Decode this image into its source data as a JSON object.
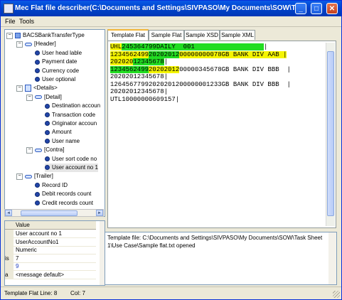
{
  "window": {
    "title": "Mec Flat file describer(C:\\Documents and Settings\\SIVPASO\\My Documents\\SOW\\Task...",
    "controls": [
      "_",
      "□",
      "✕"
    ]
  },
  "menu": [
    {
      "label": "File",
      "mnemonic": "F"
    },
    {
      "label": "Tools",
      "mnemonic": "T"
    }
  ],
  "tree": {
    "nodes": [
      {
        "label": "BACSBankTransferType",
        "icon": "root-schema-icon",
        "expander": "−"
      },
      {
        "label": "[Header]",
        "icon": "group-icon",
        "expander": "−"
      },
      {
        "label": "User head lable",
        "icon": "field-icon"
      },
      {
        "label": "Payment date",
        "icon": "field-icon"
      },
      {
        "label": "Currency code",
        "icon": "field-icon"
      },
      {
        "label": "User optional",
        "icon": "field-icon"
      },
      {
        "label": "<Details>",
        "icon": "repeating-group-icon",
        "expander": "−"
      },
      {
        "label": "[Detail]",
        "icon": "group-icon",
        "expander": "−"
      },
      {
        "label": "Destination accoun",
        "icon": "field-icon"
      },
      {
        "label": "Transaction code",
        "icon": "field-icon"
      },
      {
        "label": "Originator accoun",
        "icon": "field-icon"
      },
      {
        "label": "Amount",
        "icon": "field-icon"
      },
      {
        "label": "User name",
        "icon": "field-icon"
      },
      {
        "label": "[Contra]",
        "icon": "group-icon",
        "expander": "−"
      },
      {
        "label": "User sort code no",
        "icon": "field-icon"
      },
      {
        "label": "User account no 1",
        "icon": "field-icon"
      },
      {
        "label": "[Trailer]",
        "icon": "group-icon",
        "expander": "−"
      },
      {
        "label": "Record ID",
        "icon": "field-icon"
      },
      {
        "label": "Debit records count",
        "icon": "field-icon"
      },
      {
        "label": "Credit records count",
        "icon": "field-icon"
      }
    ]
  },
  "properties": {
    "header_key": "",
    "header_value": "Value",
    "rows": [
      {
        "key": "",
        "value": "User account no 1"
      },
      {
        "key": "",
        "value": "UserAccountNo1"
      },
      {
        "key": "",
        "value": "Numeric"
      },
      {
        "key": "is",
        "value": "7"
      },
      {
        "key": "",
        "value": "9"
      },
      {
        "key": "a",
        "value": "<message default>"
      }
    ]
  },
  "tabs": [
    {
      "label": "Template Flat",
      "active": true
    },
    {
      "label": "Sample Flat",
      "active": false
    },
    {
      "label": "Sample XSD",
      "active": false
    },
    {
      "label": "Sample XML",
      "active": false
    }
  ],
  "editor": {
    "colors": {
      "green": "#22dd22",
      "yellow": "#f5f500",
      "green2": "#33e333"
    },
    "lines": [
      [
        {
          "t": "UHL",
          "c": "yellow"
        },
        {
          "t": "245364799",
          "c": "green"
        },
        {
          "t": "DAILY  001",
          "c": "green"
        },
        {
          "t": "                  ",
          "c": "green"
        },
        {
          "t": "|",
          "c": ""
        }
      ],
      [
        {
          "t": "1234562499",
          "c": "yellow"
        },
        {
          "t": "20202012",
          "c": "green"
        },
        {
          "t": "00000000078",
          "c": "yellow"
        },
        {
          "t": "GB BANK DIV AAB ",
          "c": "yellow"
        },
        {
          "t": "|",
          "c": "yellow"
        }
      ],
      [
        {
          "t": "202020",
          "c": "yellow"
        },
        {
          "t": "12345678",
          "c": "green"
        },
        {
          "t": "|",
          "c": ""
        }
      ],
      [
        {
          "t": "1234562499",
          "c": "green"
        },
        {
          "t": "20202012",
          "c": "yellow"
        },
        {
          "t": "00000345678GB BANK DIV BBB  |",
          "c": ""
        }
      ],
      [
        {
          "t": "20202012345678|",
          "c": ""
        }
      ],
      [
        {
          "t": "12645677992020201200000001233GB BANK DIV BBB  |",
          "c": ""
        }
      ],
      [
        {
          "t": "20202012345678|",
          "c": ""
        }
      ],
      [
        {
          "t": "UTL10000000609157|",
          "c": ""
        }
      ]
    ]
  },
  "log": {
    "text": "Template file: C:\\Documents and Settings\\SIVPASO\\My Documents\\SOW\\Task Sheet 1\\Use Case\\Sample flat.txt opened"
  },
  "status": {
    "line_label": "Template Flat Line: 8",
    "col_label": "Col: 7"
  }
}
